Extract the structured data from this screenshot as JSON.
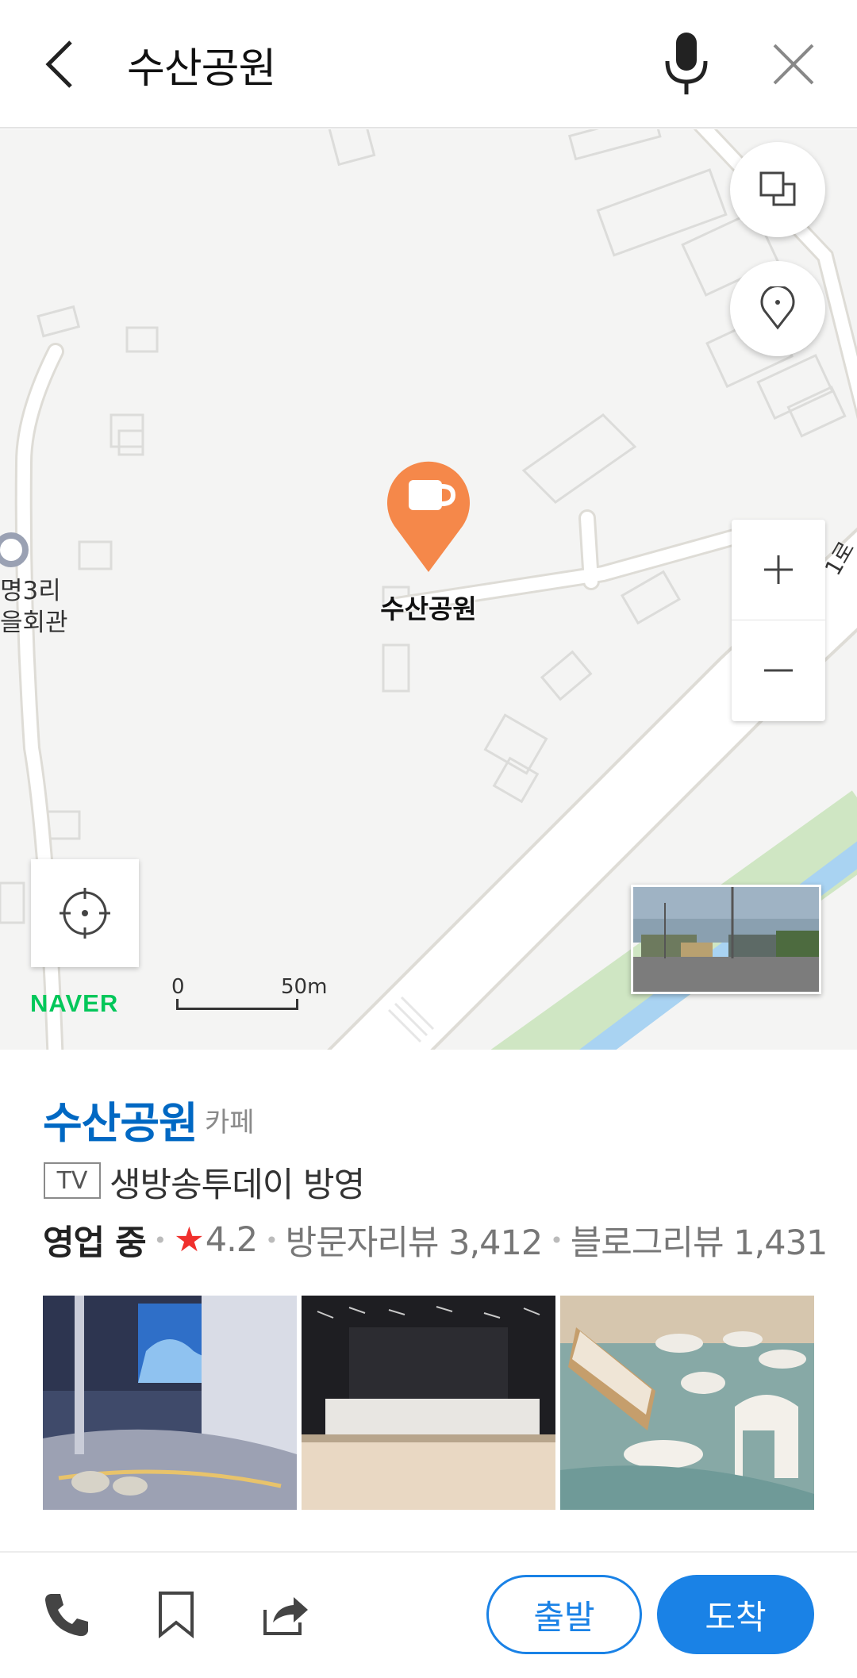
{
  "search": {
    "query": "수산공원"
  },
  "icons": {
    "back": "chevron-left-icon",
    "mic": "microphone-icon",
    "close": "close-icon",
    "layers": "layers-icon",
    "pin": "location-pin-icon",
    "zoom_in": "plus-icon",
    "zoom_out": "minus-icon",
    "locate": "crosshair-icon",
    "cafe": "coffee-cup-icon",
    "phone": "phone-icon",
    "bookmark": "bookmark-icon",
    "share": "share-icon"
  },
  "map": {
    "marker_label": "수산공원",
    "poi_line1": "명3리",
    "poi_line2": "을회관",
    "road_label": "1로",
    "logo": "NAVER",
    "scale_min": "0",
    "scale_max": "50m",
    "marker_color": "#f5884a"
  },
  "place": {
    "name": "수산공원",
    "category": "카페",
    "tv_badge": "TV",
    "tv_text": "생방송투데이 방영",
    "status": "영업 중",
    "rating": "4.2",
    "visitor_reviews": "방문자리뷰 3,412",
    "blog_reviews": "블로그리뷰 1,431"
  },
  "actions": {
    "depart": "출발",
    "arrive": "도착"
  },
  "colors": {
    "accent": "#1a82e6",
    "title": "#0068c3",
    "star": "#f0302d",
    "naver": "#03c75a"
  }
}
